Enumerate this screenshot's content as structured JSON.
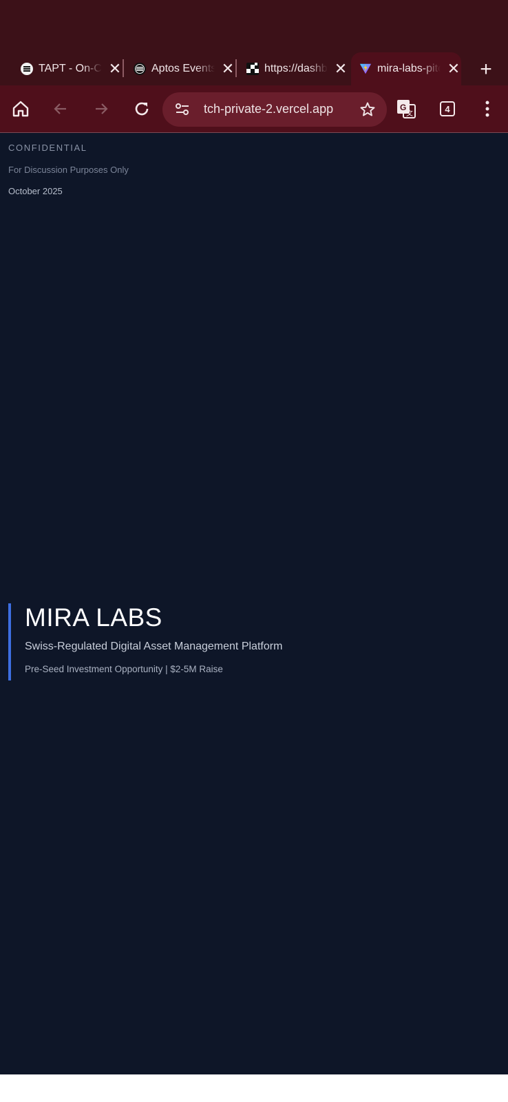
{
  "tabs": [
    {
      "title": "TAPT - On-Chain Rewards",
      "favicon": "tapt-logo-icon",
      "active": false
    },
    {
      "title": "Aptos Events",
      "favicon": "aptos-logo-icon",
      "active": false
    },
    {
      "title": "https://dashboard",
      "favicon": "checker-logo-icon",
      "active": false
    },
    {
      "title": "mira-labs-pitch",
      "favicon": "vite-logo-icon",
      "active": true
    }
  ],
  "toolbar": {
    "url": "tch-private-2.vercel.app",
    "tab_count": "4"
  },
  "page": {
    "confidential": "CONFIDENTIAL",
    "discussion": "For Discussion Purposes Only",
    "date": "October 2025",
    "title": "MIRA LABS",
    "subtitle": "Swiss-Regulated Digital Asset Management Platform",
    "tagline": "Pre-Seed Investment Opportunity | $2-5M Raise"
  },
  "colors": {
    "browser_chrome": "#3c1118",
    "toolbar": "#4f0f1b",
    "page_background": "#0e1628",
    "accent_bar": "#3d6ee0"
  }
}
